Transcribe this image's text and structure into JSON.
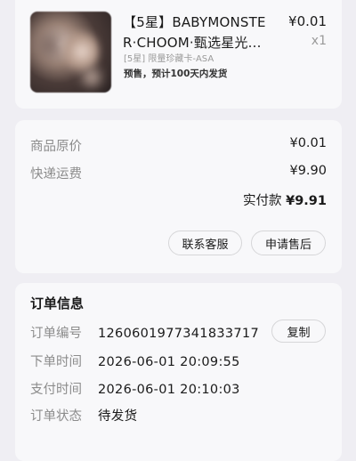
{
  "product": {
    "title_line1": "【5星】BABYMONSTE",
    "title_line2": "R·CHOOM·甄选星光...",
    "price": "¥0.01",
    "quantity": "x1",
    "variant": "[5星] 限量珍藏卡-ASA",
    "shipping_note": "预售，预计100天内发货"
  },
  "price_summary": {
    "original_label": "商品原价",
    "original_value": "¥0.01",
    "shipping_label": "快递运费",
    "shipping_value": "¥9.90",
    "paid_label": "实付款",
    "paid_value": "¥9.91",
    "service_button": "联系客服",
    "aftersale_button": "申请售后"
  },
  "order_info": {
    "heading": "订单信息",
    "number_label": "订单编号",
    "number_value": "1260601977341833717",
    "copy_button": "复制",
    "order_time_label": "下单时间",
    "order_time_value": "2026-06-01 20:09:55",
    "pay_time_label": "支付时间",
    "pay_time_value": "2026-06-01 20:10:03",
    "status_label": "订单状态",
    "status_value": "待发货"
  }
}
